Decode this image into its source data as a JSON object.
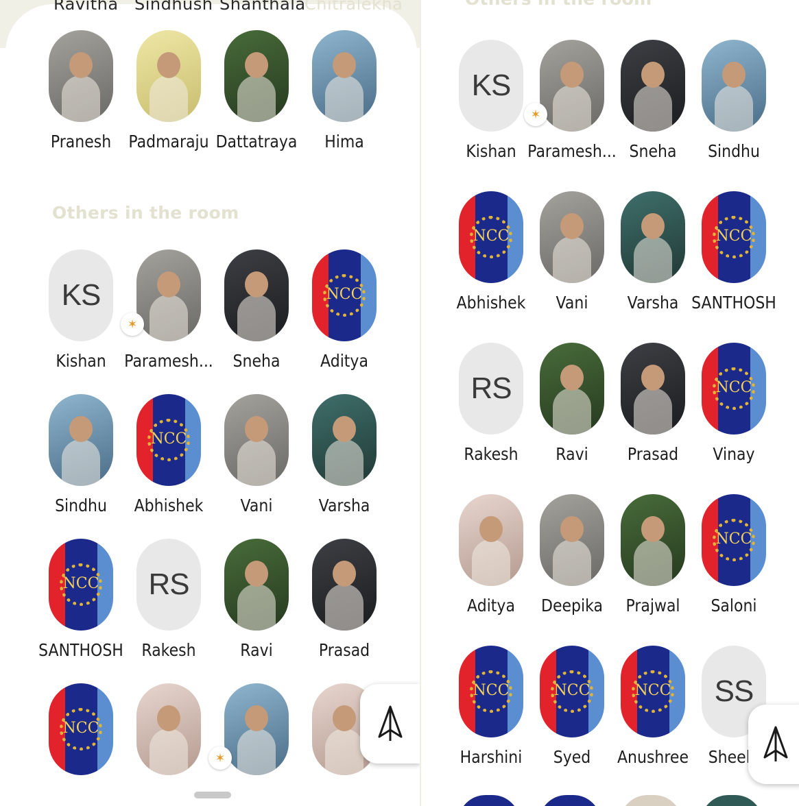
{
  "left": {
    "cutoff_names": [
      "Ravitha",
      "Sindhush",
      "Shanthala",
      "Chitralekha"
    ],
    "speakers": [
      {
        "name": "Pranesh",
        "kind": "photo",
        "style": "gray"
      },
      {
        "name": "Padmaraju",
        "kind": "photo",
        "style": "yellow"
      },
      {
        "name": "Dattatraya",
        "kind": "photo",
        "style": "green"
      },
      {
        "name": "Hima",
        "kind": "photo",
        "style": "blue"
      }
    ],
    "section_title": "Others in the room",
    "others": [
      {
        "name": "Kishan",
        "kind": "initials",
        "initials": "KS"
      },
      {
        "name": "Paramesh...",
        "kind": "photo",
        "style": "gray",
        "badge": true
      },
      {
        "name": "Sneha",
        "kind": "photo",
        "style": "dark"
      },
      {
        "name": "Aditya",
        "kind": "ncc"
      },
      {
        "name": "Sindhu",
        "kind": "photo",
        "style": "blue"
      },
      {
        "name": "Abhishek",
        "kind": "ncc"
      },
      {
        "name": "Vani",
        "kind": "photo",
        "style": "gray"
      },
      {
        "name": "Varsha",
        "kind": "photo",
        "style": "teal"
      },
      {
        "name": "SANTHOSH",
        "kind": "ncc"
      },
      {
        "name": "Rakesh",
        "kind": "initials",
        "initials": "RS"
      },
      {
        "name": "Ravi",
        "kind": "photo",
        "style": "green"
      },
      {
        "name": "Prasad",
        "kind": "photo",
        "style": "dark"
      },
      {
        "name": "",
        "kind": "ncc"
      },
      {
        "name": "",
        "kind": "photo",
        "style": "pink"
      },
      {
        "name": "",
        "kind": "photo",
        "style": "blue",
        "badge": true
      },
      {
        "name": "",
        "kind": "photo",
        "style": "pink"
      }
    ]
  },
  "right": {
    "section_title": "Others in the room",
    "others": [
      {
        "name": "Kishan",
        "kind": "initials",
        "initials": "KS"
      },
      {
        "name": "Paramesh...",
        "kind": "photo",
        "style": "gray",
        "badge": true
      },
      {
        "name": "Sneha",
        "kind": "photo",
        "style": "dark"
      },
      {
        "name": "Sindhu",
        "kind": "photo",
        "style": "blue"
      },
      {
        "name": "Abhishek",
        "kind": "ncc"
      },
      {
        "name": "Vani",
        "kind": "photo",
        "style": "gray"
      },
      {
        "name": "Varsha",
        "kind": "photo",
        "style": "teal"
      },
      {
        "name": "SANTHOSH",
        "kind": "ncc"
      },
      {
        "name": "Rakesh",
        "kind": "initials",
        "initials": "RS"
      },
      {
        "name": "Ravi",
        "kind": "photo",
        "style": "green"
      },
      {
        "name": "Prasad",
        "kind": "photo",
        "style": "dark"
      },
      {
        "name": "Vinay",
        "kind": "ncc"
      },
      {
        "name": "Aditya",
        "kind": "photo",
        "style": "pink"
      },
      {
        "name": "Deepika",
        "kind": "photo",
        "style": "gray"
      },
      {
        "name": "Prajwal",
        "kind": "photo",
        "style": "green"
      },
      {
        "name": "Saloni",
        "kind": "ncc"
      },
      {
        "name": "Harshini",
        "kind": "ncc"
      },
      {
        "name": "Syed",
        "kind": "ncc"
      },
      {
        "name": "Anushree",
        "kind": "ncc"
      },
      {
        "name": "Sheela",
        "kind": "initials",
        "initials": "SS"
      }
    ]
  },
  "ncc_text": "NCC",
  "fab_icon": "paper-plane-icon",
  "badge_icon": "party-popper-icon",
  "colors": {
    "section_title": "#e3e1d0",
    "ncc_red": "#e2232b",
    "ncc_blue": "#1b2a8a",
    "ncc_light": "#5a8ed0"
  }
}
